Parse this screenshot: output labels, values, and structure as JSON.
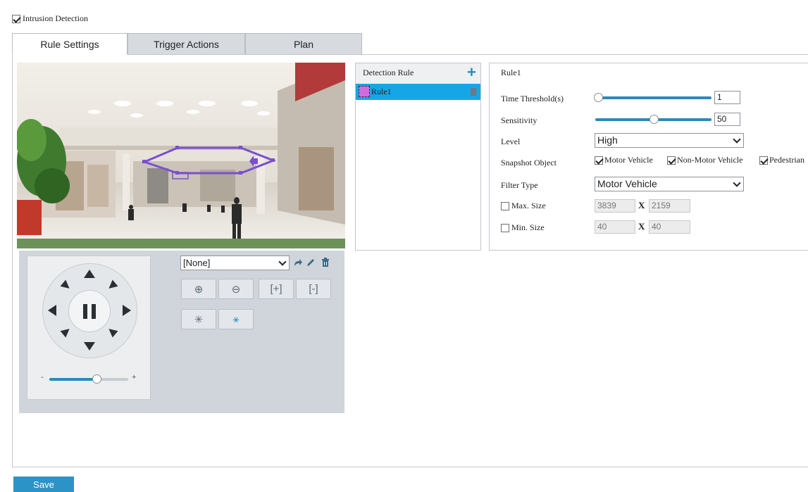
{
  "header": {
    "intrusion_label": "Intrusion Detection",
    "intrusion_checked": true
  },
  "tabs": [
    {
      "label": "Rule Settings",
      "active": true
    },
    {
      "label": "Trigger Actions",
      "active": false
    },
    {
      "label": "Plan",
      "active": false
    }
  ],
  "ptz": {
    "preset_value": "[None]",
    "speed_minus": "-",
    "speed_plus": "+",
    "speed_level": 0.6
  },
  "detection_rule": {
    "header": "Detection Rule",
    "add_icon": "plus-icon",
    "rules": [
      {
        "name": "Rule1",
        "color": "#d26be0",
        "selected": true
      }
    ]
  },
  "rule_form": {
    "title": "Rule1",
    "time_threshold_label": "Time Threshold(s)",
    "time_threshold_value": "1",
    "time_threshold_level": 0.0,
    "sensitivity_label": "Sensitivity",
    "sensitivity_value": "50",
    "sensitivity_level": 0.5,
    "level_label": "Level",
    "level_value": "High",
    "snapshot_label": "Snapshot Object",
    "snapshot_options": [
      {
        "label": "Motor Vehicle",
        "checked": true
      },
      {
        "label": "Non-Motor Vehicle",
        "checked": true
      },
      {
        "label": "Pedestrian",
        "checked": true
      }
    ],
    "filter_type_label": "Filter Type",
    "filter_type_value": "Motor Vehicle",
    "max_size_label": "Max. Size",
    "max_w": "3839",
    "max_h": "2159",
    "min_size_label": "Min. Size",
    "min_w": "40",
    "min_h": "40",
    "x_label": "X"
  },
  "footer": {
    "save_label": "Save"
  },
  "colors": {
    "accent": "#2d93c6",
    "selected_row": "#15a6e8",
    "region": "#7a4fd0"
  }
}
